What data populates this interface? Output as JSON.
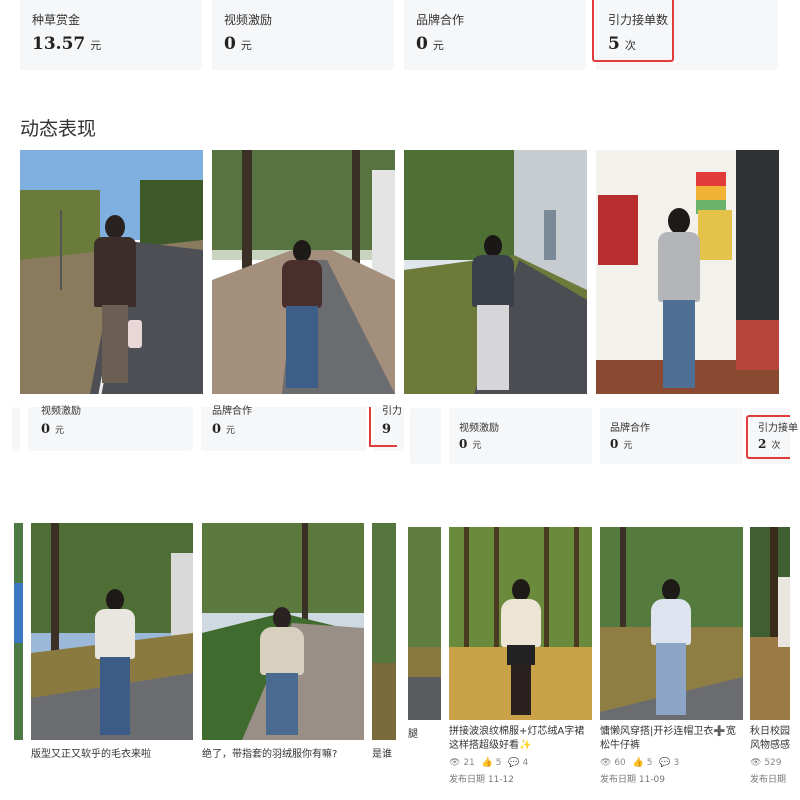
{
  "top_stats": [
    {
      "label": "种草赏金",
      "value": "13.57",
      "unit": "元"
    },
    {
      "label": "视频激励",
      "value": "0",
      "unit": "元"
    },
    {
      "label": "品牌合作",
      "value": "0",
      "unit": "元"
    },
    {
      "label": "引力接单数",
      "value": "5",
      "unit": "次"
    }
  ],
  "section_title": "动态表现",
  "mid_stats_left": [
    {
      "label": "视频激励",
      "value": "0",
      "unit": "元"
    },
    {
      "label": "品牌合作",
      "value": "0",
      "unit": "元"
    },
    {
      "label": "引力",
      "value": "9",
      "unit": ""
    }
  ],
  "mid_stats_right": [
    {
      "label": "视频激励",
      "value": "0",
      "unit": "元"
    },
    {
      "label": "品牌合作",
      "value": "0",
      "unit": "元"
    },
    {
      "label": "引力接单",
      "value": "2",
      "unit": "次"
    }
  ],
  "bottom_left_captions": [
    "版型又正又软乎的毛衣来啦",
    "绝了，带指套的羽绒服你有嘛?",
    "是谁"
  ],
  "bottom_right_posts": [
    {
      "caption_pre": "腿",
      "caption": "拼接波浪纹棉服+灯芯绒A字裙这样搭超级好看✨",
      "views": "21",
      "likes": "5",
      "comments": "4",
      "date": "发布日期 11-12"
    },
    {
      "caption": "慵懒风穿搭|开衫连帽卫衣➕宽松牛仔裤",
      "views": "60",
      "likes": "5",
      "comments": "3",
      "date": "发布日期 11-09"
    },
    {
      "caption": "秋日校园风物感感",
      "views": "529",
      "likes": "",
      "comments": "",
      "date": "发布日期"
    }
  ],
  "colors": {
    "highlight": "#e23b3b",
    "card_bg": "#f6f7f9"
  }
}
